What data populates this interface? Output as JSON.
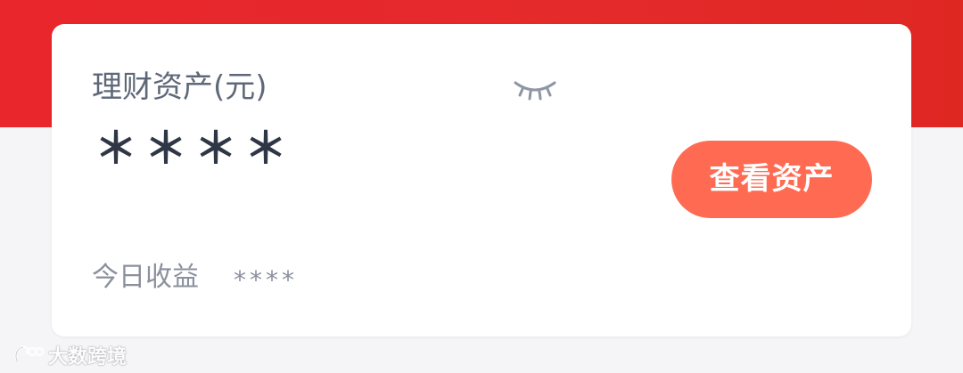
{
  "card": {
    "title": "理财资产(元)",
    "masked_amount": "＊＊＊＊",
    "view_button_label": "查看资产",
    "today_label": "今日收益",
    "today_value": "****"
  },
  "icons": {
    "visibility_toggle": "closed-eye-icon"
  },
  "watermark": {
    "text": "大数跨境"
  },
  "colors": {
    "banner_red": "#e52a2c",
    "button": "#ff6b52",
    "title_text": "#5f6878",
    "amount_text": "#2f3645",
    "muted_text": "#8a909c"
  }
}
